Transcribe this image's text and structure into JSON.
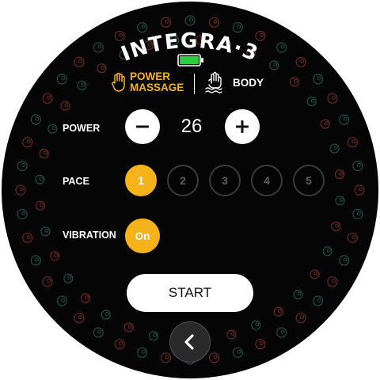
{
  "app": {
    "title": "INTEGRA·3"
  },
  "battery": {
    "level": 1.0,
    "color": "#2ecc40",
    "icon": "battery-icon"
  },
  "modes": {
    "power_massage": {
      "line1": "POWER",
      "line2": "MASSAGE",
      "icon": "hand-icon",
      "color": "#f6b21b",
      "selected": true
    },
    "body": {
      "label": "BODY",
      "icon": "hand-waves-icon",
      "selected": false
    }
  },
  "power": {
    "label": "POWER",
    "value": "26",
    "decrease_icon": "minus-icon",
    "increase_icon": "plus-icon"
  },
  "pace": {
    "label": "PACE",
    "options": [
      "1",
      "2",
      "3",
      "4",
      "5"
    ],
    "selected": "1"
  },
  "vibration": {
    "label": "VIBRATION",
    "value": "On"
  },
  "start": {
    "label": "START"
  },
  "back": {
    "icon": "chevron-left-icon"
  },
  "colors": {
    "accent": "#f6b21b",
    "background": "#050505",
    "ring_red": "#6a2a22",
    "ring_teal": "#1f4f48"
  }
}
